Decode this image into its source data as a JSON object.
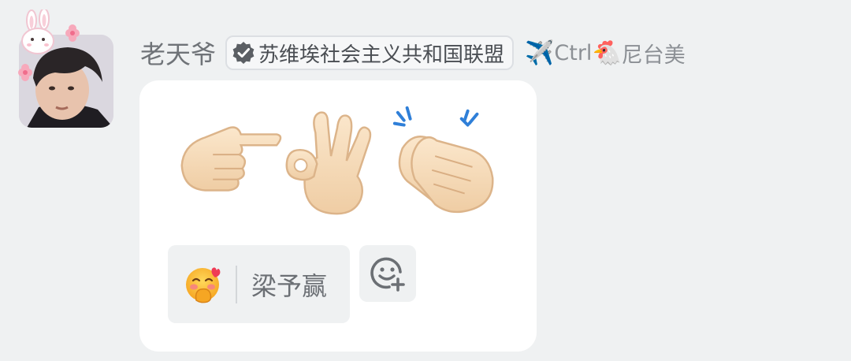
{
  "sender": {
    "avatar_icon": "user-avatar-photo",
    "nickname": "老天爷",
    "badge": {
      "icon": "verified-badge-icon",
      "text": "苏维埃社会主义共和国联盟"
    },
    "suffix": {
      "airplane_emoji": "✈️",
      "text_ctrl": "Ctrl",
      "chicken_emoji": "🐔",
      "text_end": "尼台美"
    }
  },
  "message": {
    "emojis": [
      "pointing-right-hand",
      "ok-hand",
      "clapping-hands"
    ],
    "reactions": [
      {
        "emoji": "face-with-hand-over-mouth",
        "user": "梁予赢"
      }
    ],
    "add_reaction_icon": "add-emoji-reaction-icon"
  },
  "colors": {
    "background": "#eff1f2",
    "bubble": "#ffffff",
    "nickname": "#6f7378",
    "skin": "#f5d8b3"
  }
}
